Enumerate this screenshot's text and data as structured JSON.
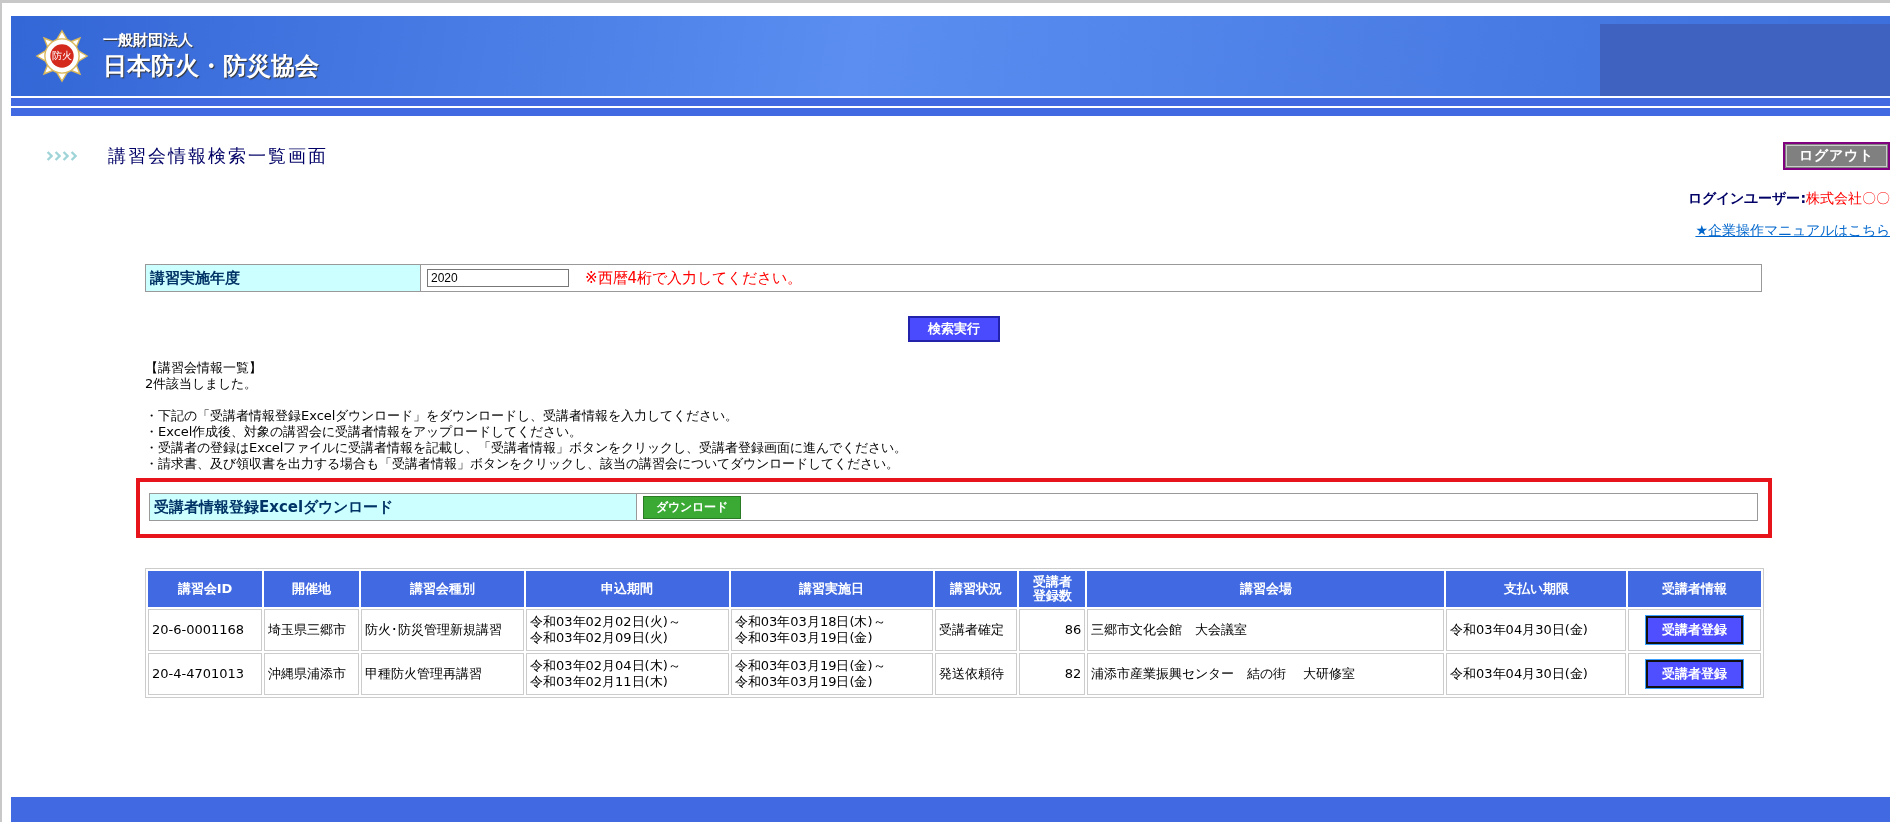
{
  "header": {
    "org_type": "一般財団法人",
    "org_name": "日本防火・防災協会",
    "logo_mark": "防火"
  },
  "page_title": "講習会情報検索一覧画面",
  "logout_button": "ログアウト",
  "login_user": {
    "label": "ログインユーザー:",
    "value": "株式会社〇〇"
  },
  "manual_link": "★企業操作マニュアルはこちら",
  "search_form": {
    "label": "講習実施年度",
    "value": "2020",
    "hint": "※西暦4桁で入力してください。"
  },
  "search_button": "検索実行",
  "list_heading": "【講習会情報一覧】",
  "result_count": "2件該当しました。",
  "notes": [
    "・下記の「受講者情報登録Excelダウンロード」をダウンロードし、受講者情報を入力してください。",
    "・Excel作成後、対象の講習会に受講者情報をアップロードしてください。",
    "・受講者の登録はExcelファイルに受講者情報を記載し、「受講者情報」ボタンをクリックし、受講者登録画面に進んでください。",
    "・請求書、及び領収書を出力する場合も「受講者情報」ボタンをクリックし、該当の講習会についてダウンロードしてください。"
  ],
  "download": {
    "label": "受講者情報登録Excelダウンロード",
    "button": "ダウンロード",
    "highlighted": true
  },
  "table": {
    "columns": [
      "講習会ID",
      "開催地",
      "講習会種別",
      "申込期間",
      "講習実施日",
      "講習状況",
      "受講者登録数",
      "講習会場",
      "支払い期限",
      "受講者情報"
    ],
    "rows": [
      {
        "id": "20-6-0001168",
        "city": "埼玉県三郷市",
        "type": "防火･防災管理新規講習",
        "application_period": [
          "令和03年02月02日(火)～",
          "令和03年02月09日(火)"
        ],
        "course_dates": [
          "令和03年03月18日(木)～",
          "令和03年03月19日(金)"
        ],
        "status": "受講者確定",
        "registered": "86",
        "venue": "三郷市文化会館　大会議室",
        "payment_deadline": "令和03年04月30日(金)",
        "button": "受講者登録"
      },
      {
        "id": "20-4-4701013",
        "city": "沖縄県浦添市",
        "type": "甲種防火管理再講習",
        "application_period": [
          "令和03年02月04日(木)～",
          "令和03年02月11日(木)"
        ],
        "course_dates": [
          "令和03年03月19日(金)～",
          "令和03年03月19日(金)"
        ],
        "status": "発送依頼待",
        "registered": "82",
        "venue": "浦添市産業振興センター　結の街　 大研修室",
        "payment_deadline": "令和03年04月30日(金)",
        "button": "受講者登録"
      }
    ]
  }
}
